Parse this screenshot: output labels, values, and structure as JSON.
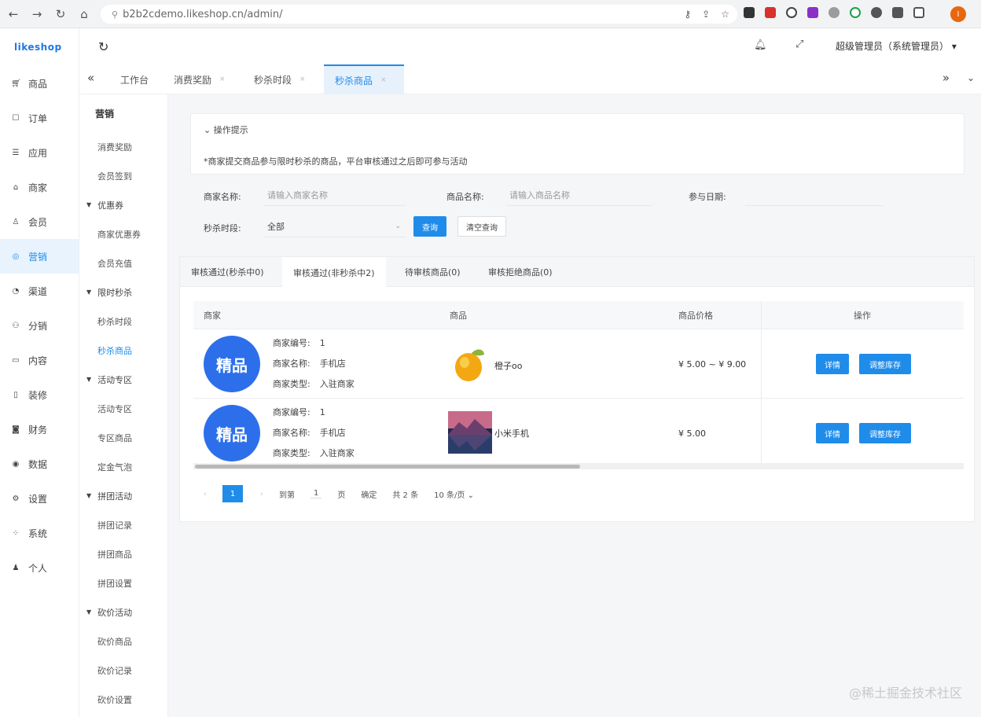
{
  "browser": {
    "url": "b2b2cdemo.likeshop.cn/admin/",
    "avatar_letter": "I"
  },
  "left_menu": {
    "logo": "likeshop",
    "items": [
      {
        "label": "商品",
        "icon": "cart-icon"
      },
      {
        "label": "订单",
        "icon": "order-icon"
      },
      {
        "label": "应用",
        "icon": "apps-icon"
      },
      {
        "label": "商家",
        "icon": "shop-icon"
      },
      {
        "label": "会员",
        "icon": "user-icon"
      },
      {
        "label": "营销",
        "icon": "marketing-icon",
        "active": true
      },
      {
        "label": "渠道",
        "icon": "channel-icon"
      },
      {
        "label": "分销",
        "icon": "distribution-icon"
      },
      {
        "label": "内容",
        "icon": "content-icon"
      },
      {
        "label": "装修",
        "icon": "decoration-icon"
      },
      {
        "label": "财务",
        "icon": "finance-icon"
      },
      {
        "label": "数据",
        "icon": "data-icon"
      },
      {
        "label": "设置",
        "icon": "settings-icon"
      },
      {
        "label": "系统",
        "icon": "system-icon"
      },
      {
        "label": "个人",
        "icon": "person-icon"
      }
    ]
  },
  "topbar": {
    "user": "超级管理员（系统管理员）"
  },
  "tabs": [
    {
      "label": "工作台"
    },
    {
      "label": "消费奖励"
    },
    {
      "label": "秒杀时段"
    },
    {
      "label": "秒杀商品",
      "active": true
    }
  ],
  "second_menu": {
    "title": "营销",
    "items": [
      {
        "label": "消费奖励",
        "type": "item"
      },
      {
        "label": "会员签到",
        "type": "item"
      },
      {
        "label": "优惠券",
        "type": "group"
      },
      {
        "label": "商家优惠券",
        "type": "item"
      },
      {
        "label": "会员充值",
        "type": "item"
      },
      {
        "label": "限时秒杀",
        "type": "group"
      },
      {
        "label": "秒杀时段",
        "type": "item"
      },
      {
        "label": "秒杀商品",
        "type": "item",
        "active": true
      },
      {
        "label": "活动专区",
        "type": "group"
      },
      {
        "label": "活动专区",
        "type": "item"
      },
      {
        "label": "专区商品",
        "type": "item"
      },
      {
        "label": "定金气泡",
        "type": "item"
      },
      {
        "label": "拼团活动",
        "type": "group"
      },
      {
        "label": "拼团记录",
        "type": "item"
      },
      {
        "label": "拼团商品",
        "type": "item"
      },
      {
        "label": "拼团设置",
        "type": "item"
      },
      {
        "label": "砍价活动",
        "type": "group"
      },
      {
        "label": "砍价商品",
        "type": "item"
      },
      {
        "label": "砍价记录",
        "type": "item"
      },
      {
        "label": "砍价设置",
        "type": "item"
      }
    ]
  },
  "tips": {
    "title": "操作提示",
    "text": "*商家提交商品参与限时秒杀的商品，平台审核通过之后即可参与活动"
  },
  "filters": {
    "shop_label": "商家名称:",
    "shop_placeholder": "请输入商家名称",
    "goods_label": "商品名称:",
    "goods_placeholder": "请输入商品名称",
    "date_label": "参与日期:",
    "period_label": "秒杀时段:",
    "period_value": "全部",
    "query": "查询",
    "reset": "清空查询"
  },
  "content_tabs": [
    {
      "label": "审核通过(秒杀中0)"
    },
    {
      "label": "审核通过(非秒杀中2)",
      "active": true
    },
    {
      "label": "待审核商品(0)"
    },
    {
      "label": "审核拒绝商品(0)"
    }
  ],
  "table": {
    "headers": {
      "shop": "商家",
      "goods": "商品",
      "price": "商品价格",
      "op": "操作"
    },
    "rows": [
      {
        "seal": "精品",
        "shop_no_label": "商家编号:",
        "shop_no": "1",
        "shop_name_label": "商家名称:",
        "shop_name": "手机店",
        "shop_type_label": "商家类型:",
        "shop_type": "入驻商家",
        "goods_name": "橙子oo",
        "price": "¥ 5.00 ~ ¥ 9.00",
        "detail": "详情",
        "adjust": "调整库存"
      },
      {
        "seal": "精品",
        "shop_no_label": "商家编号:",
        "shop_no": "1",
        "shop_name_label": "商家名称:",
        "shop_name": "手机店",
        "shop_type_label": "商家类型:",
        "shop_type": "入驻商家",
        "goods_name": "小米手机",
        "price": "¥ 5.00",
        "detail": "详情",
        "adjust": "调整库存"
      }
    ]
  },
  "pager": {
    "current": "1",
    "goto_label": "到第",
    "goto_value": "1",
    "page_unit": "页",
    "confirm": "确定",
    "total": "共 2 条",
    "per_page": "10 条/页"
  },
  "watermark": "@稀土掘金技术社区"
}
